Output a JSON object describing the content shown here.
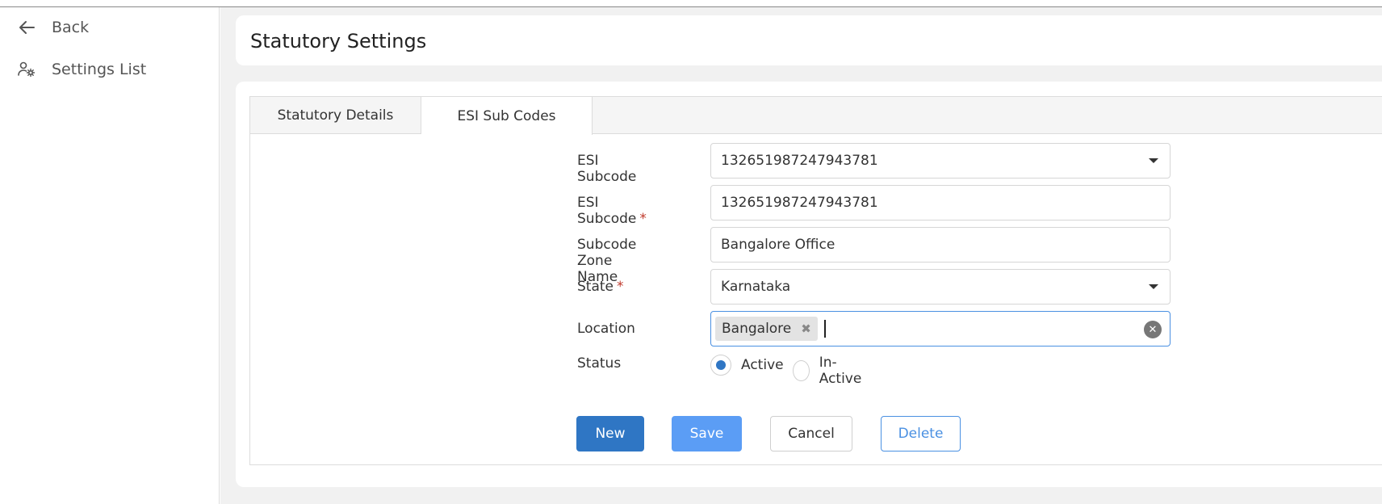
{
  "sidebar": {
    "back_label": "Back",
    "settings_list_label": "Settings List"
  },
  "page": {
    "title": "Statutory Settings"
  },
  "tabs": [
    {
      "label": "Statutory Details",
      "active": false
    },
    {
      "label": "ESI Sub Codes",
      "active": true
    }
  ],
  "form": {
    "esi_subcode_select": {
      "label": "ESI Subcode",
      "value": "132651987247943781"
    },
    "esi_subcode_input": {
      "label": "ESI Subcode",
      "required_mark": "*",
      "value": "132651987247943781"
    },
    "zone_name": {
      "label": "Subcode Zone Name",
      "value": "Bangalore Office"
    },
    "state": {
      "label": "State",
      "required_mark": "*",
      "value": "Karnataka"
    },
    "location": {
      "label": "Location",
      "chips": [
        "Bangalore"
      ]
    },
    "status": {
      "label": "Status",
      "options": [
        {
          "label": "Active",
          "selected": true
        },
        {
          "label": "In-Active",
          "selected": false
        }
      ]
    }
  },
  "buttons": {
    "new": "New",
    "save": "Save",
    "cancel": "Cancel",
    "delete": "Delete"
  },
  "colors": {
    "primary": "#2f76c4",
    "save": "#5b9df5",
    "required": "#c0392b",
    "focus": "#4a90e2"
  }
}
